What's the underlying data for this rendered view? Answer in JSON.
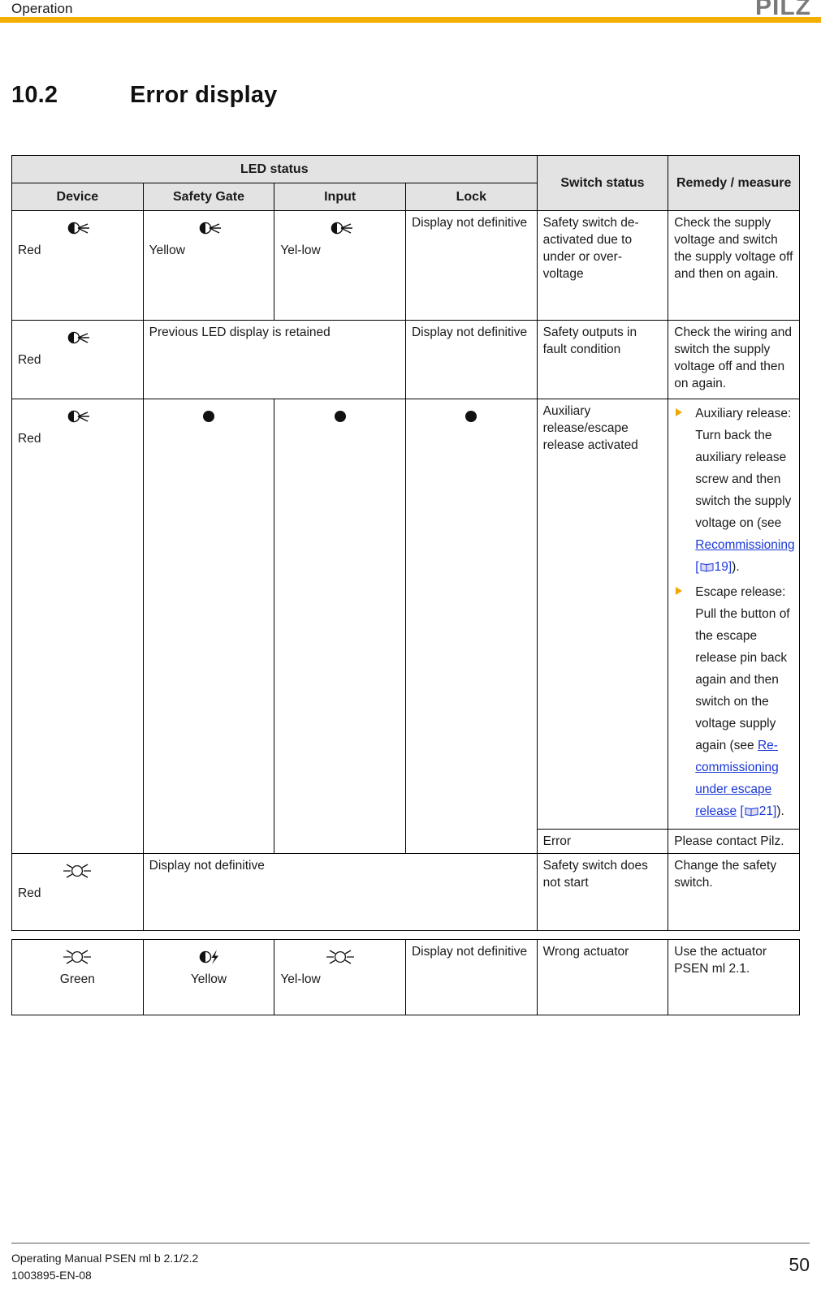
{
  "header": {
    "title": "Operation",
    "brand": "PILZ",
    "rule_color": "#F5AF02"
  },
  "section": {
    "number": "10.2",
    "title": "Error display"
  },
  "table": {
    "group_headers": {
      "led_status": "LED status",
      "switch_status": "Switch status",
      "remedy": "Remedy / measure"
    },
    "sub_headers": {
      "device": "Device",
      "safety_gate": "Safety Gate",
      "input": "Input",
      "lock": "Lock"
    },
    "rows": [
      {
        "device_icon": "led-flashing-half-icon",
        "device_label": "Red",
        "safety_gate_icon": "led-flashing-half-icon",
        "safety_gate_label": "Yellow",
        "input_icon": "led-flashing-half-icon",
        "input_label": "Yel-low",
        "lock_text": "Display not definitive",
        "switch_status": "Safety switch de-activated due to under or over-voltage",
        "remedy": "Check the supply voltage and switch the supply voltage off and then on again."
      },
      {
        "device_icon": "led-flashing-half-icon",
        "device_label": "Red",
        "span_text": "Previous LED display is retained",
        "lock_text": "Display not definitive",
        "switch_status": "Safety outputs in fault condition",
        "remedy": "Check the wiring and switch the supply voltage off and then on again."
      },
      {
        "device_icon": "led-flashing-half-icon",
        "device_label": "Red",
        "safety_gate_icon": "led-off-dot-icon",
        "input_icon": "led-off-dot-icon",
        "lock_icon": "led-off-dot-icon",
        "switch_status": "Auxiliary release/escape release activated",
        "remedy_bullets": [
          {
            "pre": "Auxiliary release: Turn back the auxiliary release screw and then switch the supply voltage on (see ",
            "link": "Recommissioning",
            "page": "19",
            "post": ")."
          },
          {
            "pre": "Escape release: Pull the button of the escape release pin back again and then switch on the voltage supply again (see ",
            "link": "Re-commissioning under escape release",
            "page": "21",
            "post": ")."
          }
        ],
        "sub_switch_status": "Error",
        "sub_remedy": "Please contact Pilz."
      },
      {
        "device_icon": "led-on-sun-icon",
        "device_label": "Red",
        "span_text": "Display not definitive",
        "switch_status": "Safety switch does not start",
        "remedy": "Change the safety switch."
      },
      {
        "device_icon": "led-on-sun-icon",
        "device_label": "Green",
        "safety_gate_icon": "led-bolt-icon",
        "safety_gate_label": "Yellow",
        "input_icon": "led-on-sun-icon",
        "input_label": "Yel-low",
        "lock_text": "Display not definitive",
        "switch_status": "Wrong actuator",
        "remedy": "Use the actuator PSEN ml 2.1."
      }
    ]
  },
  "footer": {
    "manual": "Operating Manual PSEN ml b 2.1/2.2",
    "doc_id": "1003895-EN-08",
    "page_number": "50"
  },
  "colors": {
    "brand_orange": "#F5AF02",
    "link_blue": "#1a37d8",
    "header_grey": "#e3e3e3"
  }
}
